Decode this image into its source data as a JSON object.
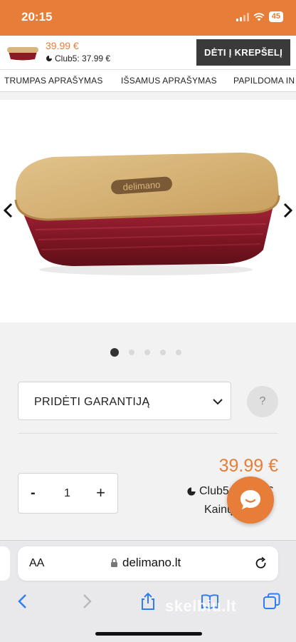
{
  "status_bar": {
    "time": "20:15",
    "battery": "45"
  },
  "sticky_bar": {
    "price": "39.99 €",
    "club_price": "Club5: 37.99 €",
    "add_to_cart_label": "DĖTI Į KREPŠELĮ"
  },
  "tabs": [
    {
      "label": "TRUMPAS APRAŠYMAS"
    },
    {
      "label": "IŠSAMUS APRAŠYMAS"
    },
    {
      "label": "PAPILDOMA IN"
    }
  ],
  "gallery": {
    "brand_on_lid": "delimano",
    "slide_count": 5,
    "active_slide": 1
  },
  "guarantee": {
    "label": "PRIDĖTI GARANTIJĄ",
    "help": "?"
  },
  "price": {
    "main": "39.99 €",
    "club": "Club5: 37.99 €",
    "history_link": "Kainų po"
  },
  "quantity": {
    "minus": "-",
    "value": "1",
    "plus": "+"
  },
  "browser": {
    "aa": "AA",
    "url": "delimano.lt"
  },
  "watermark": "skelbiu.lt",
  "colors": {
    "accent": "#e67e3a",
    "cart_button": "#3a3a3a",
    "dish_red": "#8c1a26",
    "wood": "#d8b57a"
  }
}
